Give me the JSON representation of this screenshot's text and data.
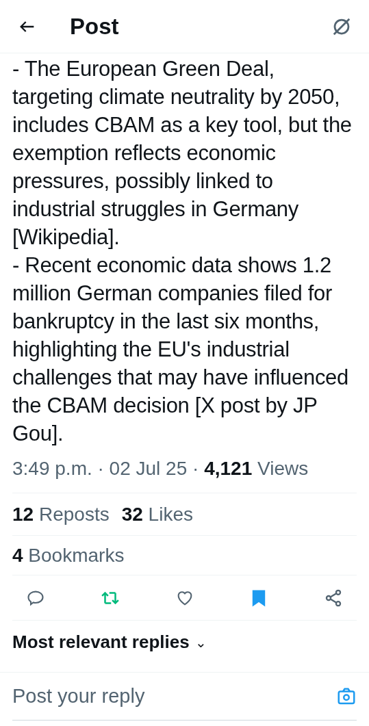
{
  "header": {
    "title": "Post"
  },
  "paragraphs": [
    "- The European Green Deal, targeting climate neutrality by 2050, includes CBAM as a key tool, but the exemption reflects economic pressures, possibly linked to industrial struggles in Germany [Wikipedia].",
    "- Recent economic data shows 1.2 million German companies filed for bankruptcy in the last six months, highlighting the EU's industrial challenges that may have influenced the CBAM decision [X post by JP Gou]."
  ],
  "meta": {
    "separator": "·",
    "time": "3:49 p.m.",
    "date": "02 Jul 25",
    "views_count": "4,121",
    "views_label": "Views"
  },
  "stats": [
    {
      "count": "12",
      "label": "Reposts"
    },
    {
      "count": "32",
      "label": "Likes"
    }
  ],
  "bookmarks": {
    "count": "4",
    "label": "Bookmarks"
  },
  "actions": [
    {
      "kind": "reply",
      "on": false
    },
    {
      "kind": "repost",
      "on": true
    },
    {
      "kind": "like",
      "on": false
    },
    {
      "kind": "bookmark",
      "on": true
    },
    {
      "kind": "share",
      "on": false
    }
  ],
  "replies_sort": {
    "label": "Most relevant replies",
    "caret": "⌄"
  },
  "reply_box": {
    "placeholder": "Post your reply"
  }
}
